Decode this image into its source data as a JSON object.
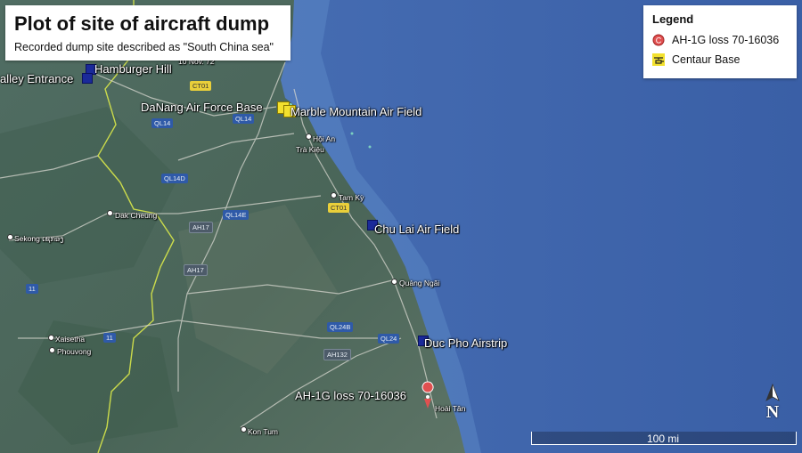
{
  "title": "Plot of site of aircraft dump",
  "subtitle": "Recorded dump site described as \"South China sea\"",
  "legend": {
    "heading": "Legend",
    "items": [
      {
        "label": "AH-1G loss 70-16036",
        "icon": "crash-marker-icon"
      },
      {
        "label": "Centaur Base",
        "icon": "helicopter-icon"
      }
    ]
  },
  "places": {
    "hamburger_hill": "Hamburger Hill",
    "valley_entrance": "alley Entrance",
    "danang": "DaNang Air Force Base",
    "marble_mountain": "Marble Mountain Air Field",
    "chu_lai": "Chu Lai Air Field",
    "duc_pho": "Duc Pho Airstrip",
    "ah1g_loss": "AH-1G loss 70-16036",
    "nov_label": "10 Nov. 72"
  },
  "towns": {
    "hoi_an": "Hội An",
    "tam_ky": "Tam Kỳ",
    "quang_ngai": "Quảng Ngãi",
    "hoai_tan": "Hoài Tân",
    "kon_tum": "Kon Tum",
    "dak_cheung": "Dak Cheung",
    "sekong": "Sekong ເຊກອງ",
    "xaisetha": "Xaisetha",
    "phouvong": "Phouvong",
    "tra_kieu": "Trà Kiệu"
  },
  "roads": {
    "ct01": "CT01",
    "ql14": "QL14",
    "ql14d": "QL14D",
    "ql14e": "QL14E",
    "ah17": "AH17",
    "ql24b": "QL24B",
    "ql24": "QL24",
    "ah132": "AH132",
    "r11": "11"
  },
  "scale_label": "100 mi",
  "compass_letter": "N",
  "colors": {
    "sea": "#3f63a8",
    "land": "#4e6a60",
    "border": "#d9e84a",
    "marker_blue": "#1a2a9a",
    "marker_yellow": "#f3e12e",
    "pin": "#e05050"
  }
}
